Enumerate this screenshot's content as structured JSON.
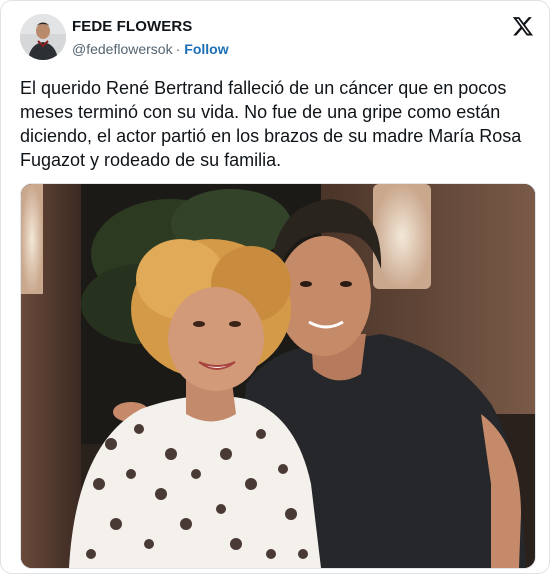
{
  "author": {
    "display_name": "FEDE FLOWERS",
    "handle": "@fedeflowersok",
    "separator": "·",
    "follow_label": "Follow"
  },
  "platform": {
    "logo_icon": "x-logo-icon"
  },
  "tweet": {
    "text": "El querido René Bertrand falleció de un cáncer que en pocos meses terminó con su vida. No fue de una gripe como están diciendo, el actor partió en los brazos de su madre María Rosa Fugazot y rodeado de su familia."
  },
  "colors": {
    "text_primary": "#0f1419",
    "text_secondary": "#536471",
    "link": "#1d70b8",
    "border": "#dfe3e6"
  }
}
